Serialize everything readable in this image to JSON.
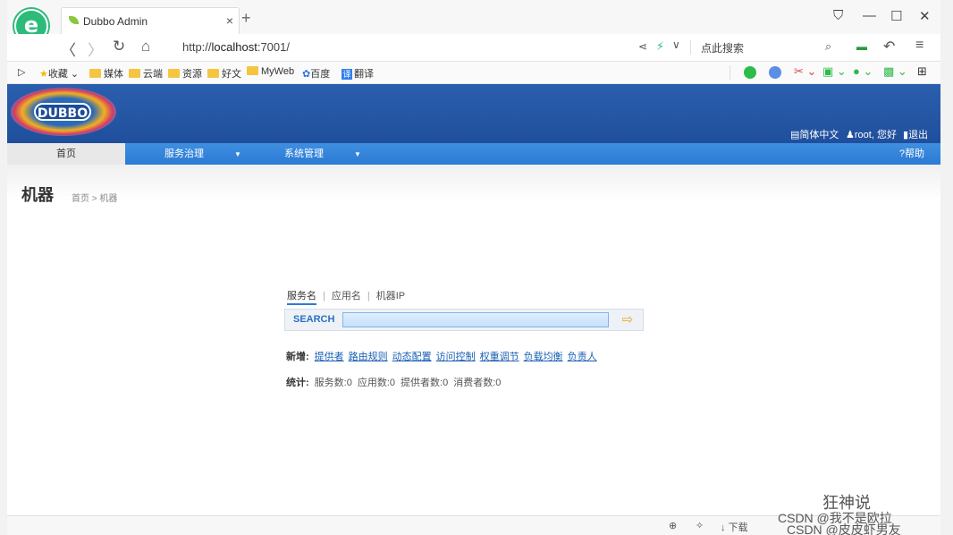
{
  "browser": {
    "tab_title": "Dubbo Admin",
    "tab_close": "×",
    "new_tab": "+",
    "url_prefix": "http://",
    "url_host": "localhost",
    "url_rest": ":7001/",
    "search_placeholder": "点此搜索",
    "bookmarks": [
      "收藏",
      "媒体",
      "云端",
      "资源",
      "好文",
      "MyWeb",
      "百度",
      "翻译"
    ],
    "status_download": "下载"
  },
  "app": {
    "logo_text": "DUBBO",
    "header_links": {
      "lang": "简体中文",
      "user": "root, 您好",
      "logout": "退出"
    },
    "menu": {
      "home": "首页",
      "service": "服务治理",
      "system": "系统管理",
      "help": "帮助"
    },
    "page_title": "机器",
    "breadcrumb": "首页 > 机器",
    "search": {
      "tabs": [
        "服务名",
        "应用名",
        "机器IP"
      ],
      "label": "SEARCH",
      "value": ""
    },
    "add": {
      "label": "新增:",
      "links": [
        "提供者",
        "路由规则",
        "动态配置",
        "访问控制",
        "权重调节",
        "负载均衡",
        "负责人"
      ]
    },
    "stats": {
      "label": "统计:",
      "items": [
        "服务数:0",
        "应用数:0",
        "提供者数:0",
        "消费者数:0"
      ]
    }
  },
  "watermark": {
    "line1": "狂神说",
    "line2": "CSDN @我不是欧拉",
    "line3": "CSDN @皮皮虾男友"
  },
  "colors": {
    "header": "#1f4f9c",
    "menu": "#2b7ad4",
    "link": "#1a5fb4",
    "brand_green": "#2dbb7a"
  }
}
